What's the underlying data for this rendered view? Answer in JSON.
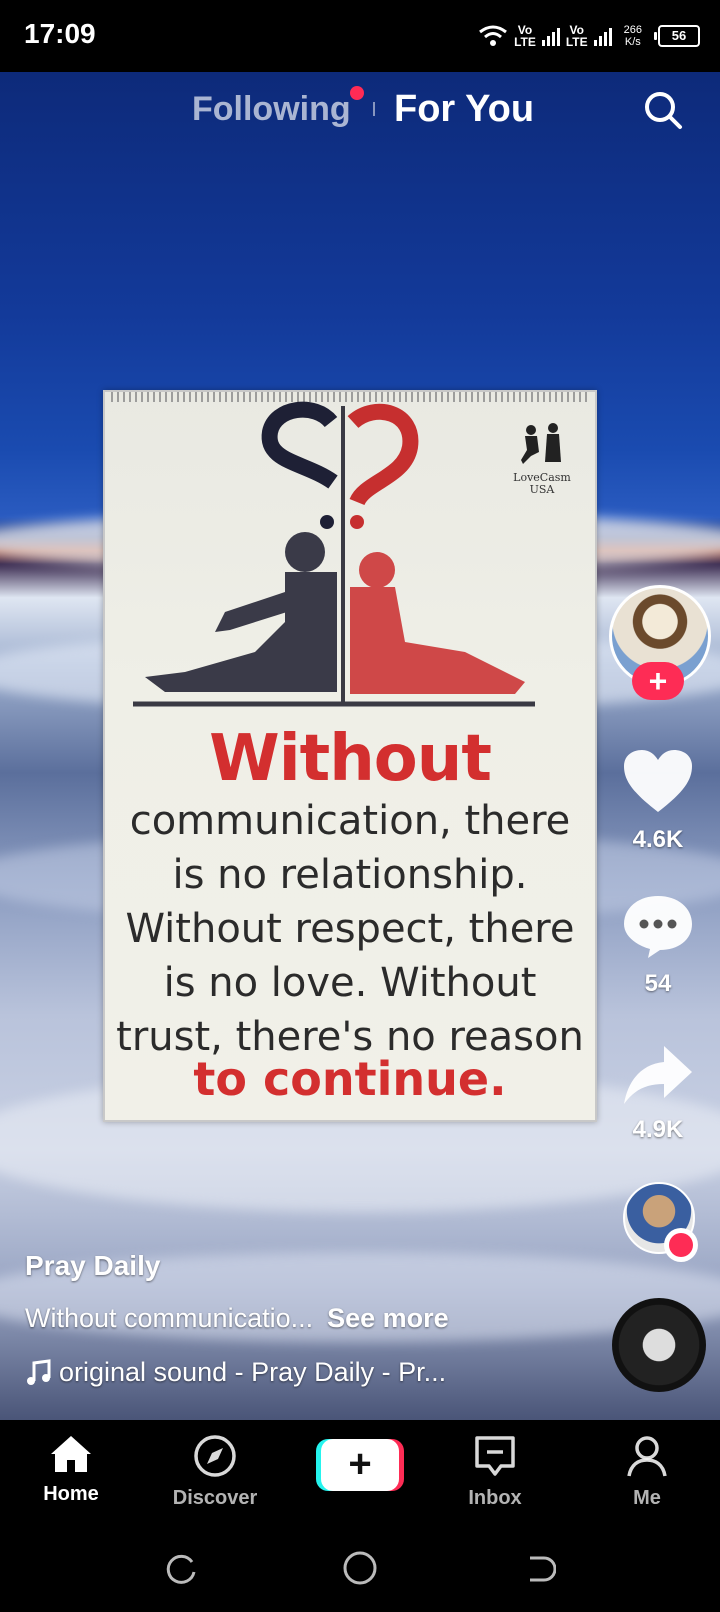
{
  "status_bar": {
    "time": "17:09",
    "lte1": "Vo\nLTE",
    "lte2": "Vo\nLTE",
    "speed": "266\nK/s",
    "battery": "56"
  },
  "top_nav": {
    "following_label": "Following",
    "foryou_label": "For You"
  },
  "video": {
    "poster": {
      "brand": "LoveCasm USA",
      "headline": "Without",
      "body_lines": [
        "communication, there",
        "is no relationship.",
        "Without respect, there",
        "is no love. Without",
        "trust, there's no reason"
      ],
      "ending": "to continue."
    }
  },
  "right_rail": {
    "likes": "4.6K",
    "comments": "54",
    "shares": "4.9K",
    "follow_symbol": "+"
  },
  "caption": {
    "creator": "Pray Daily",
    "text": "Without communicatio...",
    "see_more": "See more",
    "sound": "original sound - Pray Daily - Pr..."
  },
  "bottom_nav": {
    "home": "Home",
    "discover": "Discover",
    "create": "+",
    "inbox": "Inbox",
    "me": "Me"
  },
  "colors": {
    "accent": "#fe2c55",
    "poster_red": "#d32f2f"
  }
}
